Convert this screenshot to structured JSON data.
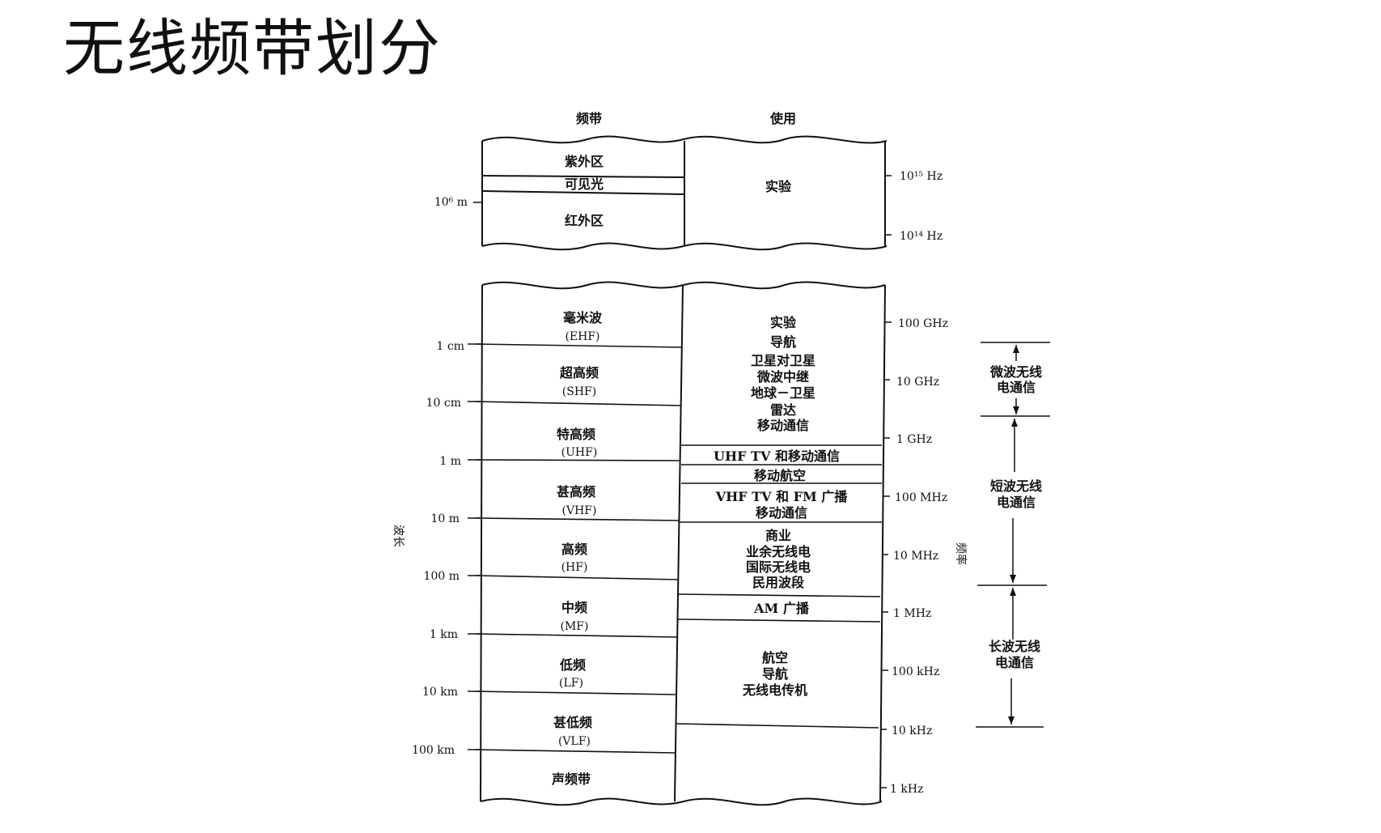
{
  "slide": {
    "title": "无线频带划分"
  },
  "headers": {
    "band": "频带",
    "usage": "使用"
  },
  "upper_section": {
    "bands": [
      "紫外区",
      "可见光",
      "红外区"
    ],
    "usage": "实验",
    "wavelength_label": "10⁶ m",
    "frequency_labels": [
      "10¹⁵ Hz",
      "10¹⁴ Hz"
    ]
  },
  "bands": [
    {
      "name": "毫米波",
      "abbr": "(EHF)"
    },
    {
      "name": "超高频",
      "abbr": "(SHF)"
    },
    {
      "name": "特高频",
      "abbr": "(UHF)"
    },
    {
      "name": "甚高频",
      "abbr": "(VHF)"
    },
    {
      "name": "高频",
      "abbr": "(HF)"
    },
    {
      "name": "中频",
      "abbr": "(MF)"
    },
    {
      "name": "低频",
      "abbr": "(LF)"
    },
    {
      "name": "甚低频",
      "abbr": "(VLF)"
    },
    {
      "name": "声频带",
      "abbr": ""
    }
  ],
  "usages": [
    [
      "实验",
      "导航",
      "卫星对卫星",
      "微波中继",
      "地球－卫星",
      "雷达",
      "移动通信"
    ],
    [
      "UHF TV  和移动通信"
    ],
    [
      "移动航空"
    ],
    [
      "VHF TV 和 FM 广播",
      "移动通信"
    ],
    [
      "商业",
      "业余无线电",
      "国际无线电",
      "民用波段"
    ],
    [
      "AM 广播"
    ],
    [
      "航空",
      "导航",
      "无线电传机"
    ],
    [
      ""
    ]
  ],
  "wavelengths": [
    "1 cm",
    "10 cm",
    "1 m",
    "10 m",
    "100 m",
    "1 km",
    "10 km",
    "100 km"
  ],
  "frequencies": [
    "100 GHz",
    "10 GHz",
    "1 GHz",
    "100 MHz",
    "10 MHz",
    "1 MHz",
    "100 kHz",
    "10 kHz",
    "1 kHz"
  ],
  "axis_labels": {
    "wavelength": "波长",
    "frequency": "频率"
  },
  "communication_types": [
    {
      "line1": "微波无线",
      "line2": "电通信"
    },
    {
      "line1": "短波无线",
      "line2": "电通信"
    },
    {
      "line1": "长波无线",
      "line2": "电通信"
    }
  ]
}
